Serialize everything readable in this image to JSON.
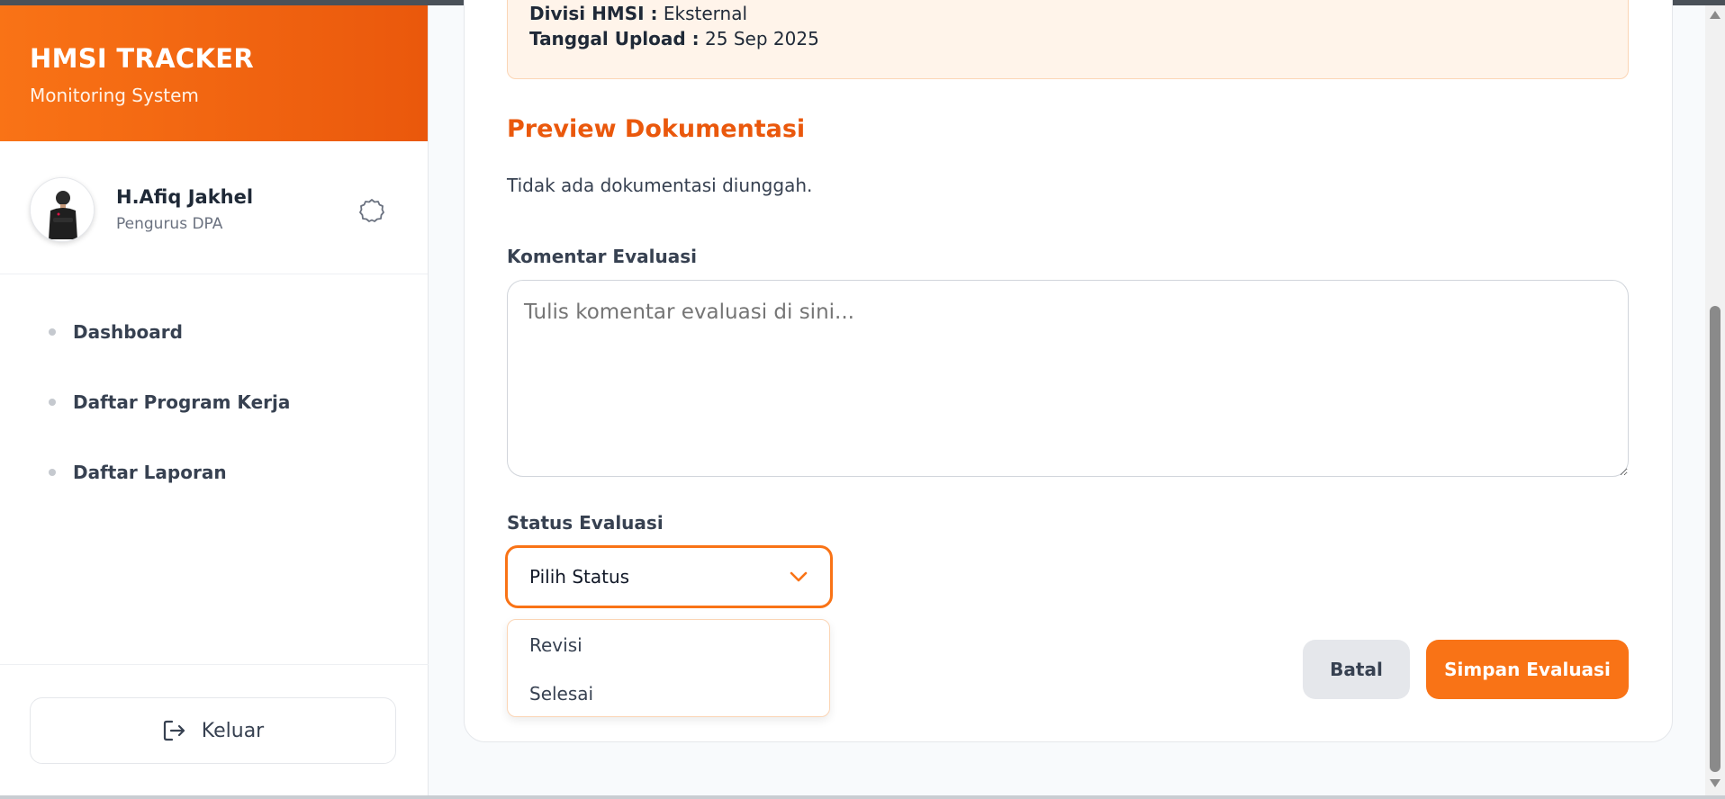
{
  "sidebar": {
    "brand_title": "HMSI TRACKER",
    "brand_subtitle": "Monitoring System",
    "user_name": "H.Afiq Jakhel",
    "user_role": "Pengurus DPA",
    "nav": [
      {
        "label": "Dashboard"
      },
      {
        "label": "Daftar Program Kerja"
      },
      {
        "label": "Daftar Laporan"
      }
    ],
    "logout_label": "Keluar"
  },
  "info": {
    "divisi_label": "Divisi HMSI :",
    "divisi_value": "Eksternal",
    "tanggal_label": "Tanggal Upload :",
    "tanggal_value": "25 Sep 2025"
  },
  "preview": {
    "title": "Preview Dokumentasi",
    "empty_text": "Tidak ada dokumentasi diunggah."
  },
  "comment": {
    "label": "Komentar Evaluasi",
    "placeholder": "Tulis komentar evaluasi di sini..."
  },
  "status": {
    "label": "Status Evaluasi",
    "selected": "Pilih Status",
    "options": [
      "Revisi",
      "Selesai"
    ]
  },
  "actions": {
    "cancel_label": "Batal",
    "save_label": "Simpan Evaluasi"
  },
  "colors": {
    "accent": "#f97316",
    "accent_dark": "#ea580c"
  }
}
